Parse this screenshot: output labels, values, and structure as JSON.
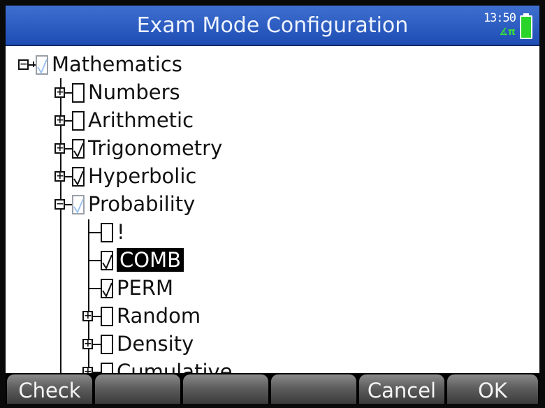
{
  "window": {
    "title": "Exam Mode Configuration",
    "clock": "13:50",
    "angle_indicator": "∡π",
    "battery_icon": "battery-icon"
  },
  "tree": {
    "root": {
      "label": "Mathematics",
      "expander": "⊟",
      "checked": "partial"
    },
    "items": [
      {
        "label": "Numbers",
        "expander": "⊞",
        "checked": false
      },
      {
        "label": "Arithmetic",
        "expander": "⊞",
        "checked": false
      },
      {
        "label": "Trigonometry",
        "expander": "⊞",
        "checked": true
      },
      {
        "label": "Hyperbolic",
        "expander": "⊞",
        "checked": true
      },
      {
        "label": "Probability",
        "expander": "⊟",
        "checked": "partial"
      }
    ],
    "probability_children": [
      {
        "label": "!",
        "checked": false,
        "selected": false
      },
      {
        "label": "COMB",
        "checked": true,
        "selected": true
      },
      {
        "label": "PERM",
        "checked": true,
        "selected": false
      },
      {
        "label": "Random",
        "expander": "⊞",
        "checked": false
      },
      {
        "label": "Density",
        "expander": "⊞",
        "checked": false
      },
      {
        "label": "Cumulative",
        "expander": "⊞",
        "checked": false
      }
    ]
  },
  "softkeys": [
    "Check",
    "",
    "",
    "",
    "Cancel",
    "OK"
  ],
  "colors": {
    "titlebar": "#2a5cc4",
    "selection": "#000000",
    "battery": "#2bd42b",
    "partial_check": "#9aa0a8"
  }
}
